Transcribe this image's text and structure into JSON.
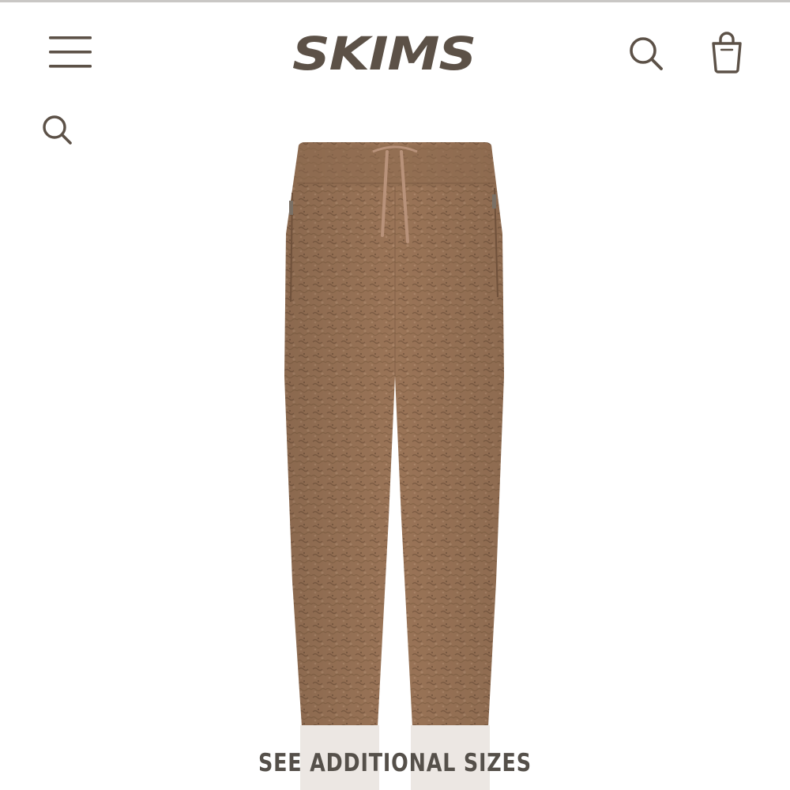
{
  "header": {
    "logo_text": "SKIMS",
    "menu_icon": "hamburger-menu-icon",
    "search_icon": "search-icon",
    "bag_icon": "shopping-bag-icon"
  },
  "secondary_search": {
    "icon": "search-icon"
  },
  "product": {
    "image": "product-image-fleece-jogger-pants",
    "color": "#9a7457"
  },
  "cta": {
    "see_additional_sizes": "SEE ADDITIONAL SIZES"
  },
  "colors": {
    "brand": "#5c5147",
    "text": "#55504a",
    "rule": "#c9c7c5"
  }
}
